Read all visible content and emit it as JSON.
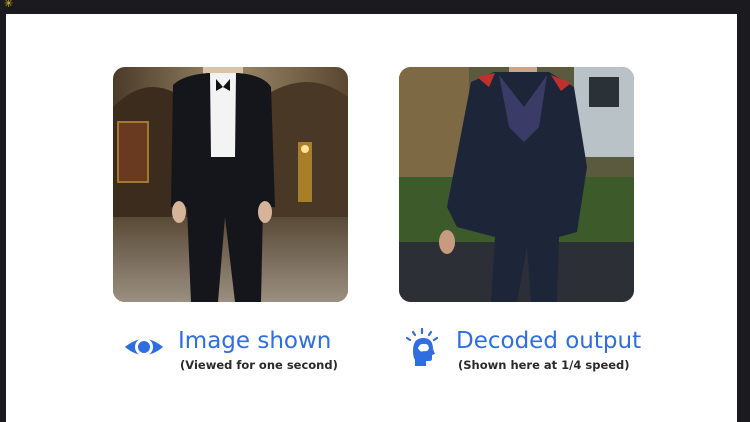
{
  "left_panel": {
    "icon": "eye-icon",
    "title": "Image shown",
    "subtitle": "(Viewed for one second)"
  },
  "right_panel": {
    "icon": "head-with-brain-signal-icon",
    "title": "Decoded output",
    "subtitle": "(Shown here at 1/4 speed)"
  },
  "colors": {
    "accent": "#2f6ee0",
    "frame": "#1b1b1f",
    "slide": "#ffffff"
  }
}
